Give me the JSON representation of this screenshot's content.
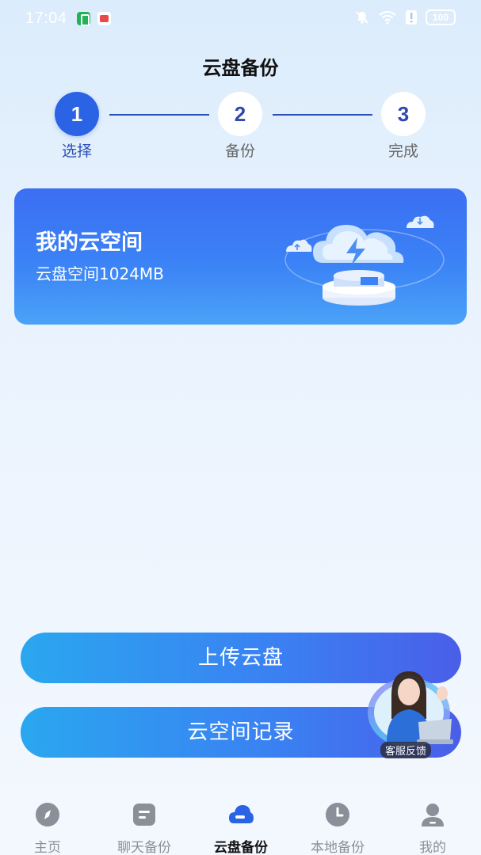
{
  "status_bar": {
    "time": "17:04",
    "battery": "100"
  },
  "header": {
    "title": "云盘备份"
  },
  "stepper": {
    "steps": [
      {
        "number": "1",
        "label": "选择"
      },
      {
        "number": "2",
        "label": "备份"
      },
      {
        "number": "3",
        "label": "完成"
      }
    ],
    "current_step": 1
  },
  "cloud_card": {
    "title": "我的云空间",
    "subtitle": "云盘空间1024MB"
  },
  "actions": {
    "upload_label": "上传云盘",
    "records_label": "云空间记录"
  },
  "support": {
    "label": "客服反馈"
  },
  "bottom_nav": {
    "items": [
      {
        "label": "主页",
        "icon": "compass-icon"
      },
      {
        "label": "聊天备份",
        "icon": "chat-doc-icon"
      },
      {
        "label": "云盘备份",
        "icon": "cloud-icon"
      },
      {
        "label": "本地备份",
        "icon": "clock-icon"
      },
      {
        "label": "我的",
        "icon": "person-icon"
      }
    ],
    "active_index": 2
  },
  "colors": {
    "accent": "#2b63e5",
    "step_line": "#2d4fb6",
    "nav_inactive": "#8a8f99"
  }
}
